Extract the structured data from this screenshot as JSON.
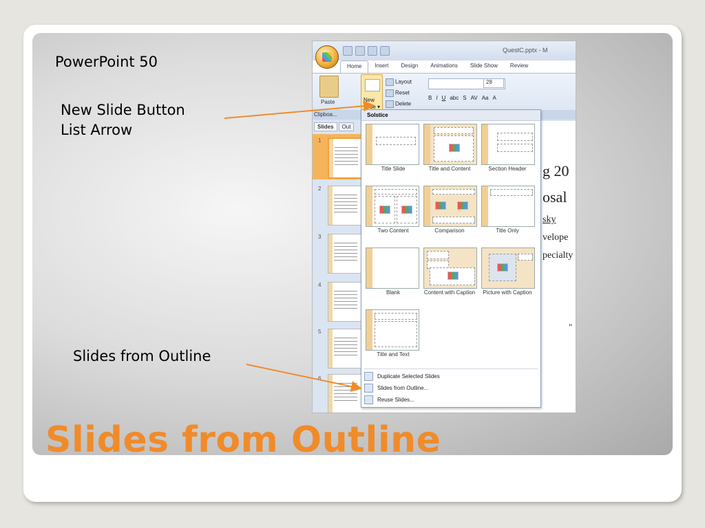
{
  "labels": {
    "top_left": "PowerPoint 50",
    "new_slide_1": "New Slide Button",
    "new_slide_2": "List Arrow",
    "slides_from_outline": "Slides from Outline"
  },
  "title": "Slides from Outline",
  "colors": {
    "accent": "#f08b2a",
    "arrow": "#f08b2a",
    "panel": "#c8c8c8"
  },
  "app": {
    "window_title": "QuestC.pptx - M",
    "tabs": [
      "Home",
      "Insert",
      "Design",
      "Animations",
      "Slide Show",
      "Review"
    ],
    "ribbon": {
      "paste": "Paste",
      "new_slide_1": "New",
      "new_slide_2": "Slide",
      "layout": "Layout",
      "reset": "Reset",
      "delete": "Delete",
      "font_size": "28",
      "clipboard_group": "Clipboa..."
    },
    "pane_tabs": [
      "Slides",
      "Out"
    ],
    "slide_numbers": [
      "1",
      "2",
      "3",
      "4",
      "5",
      "6"
    ],
    "slide_text": [
      "g 20",
      "osal",
      "sky",
      "velope",
      "pecialty",
      "\""
    ]
  },
  "gallery": {
    "theme": "Solstice",
    "layouts": [
      "Title Slide",
      "Title and Content",
      "Section Header",
      "Two Content",
      "Comparison",
      "Title Only",
      "Blank",
      "Content with Caption",
      "Picture with Caption",
      "Title and Text"
    ],
    "menu": [
      "Duplicate Selected Slides",
      "Slides from Outline...",
      "Reuse Slides..."
    ]
  }
}
